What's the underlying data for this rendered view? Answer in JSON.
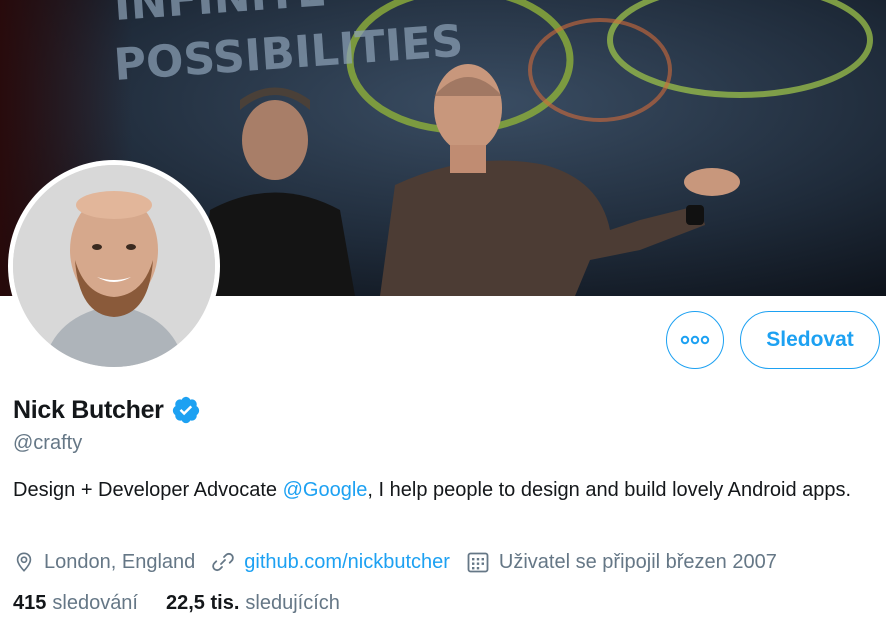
{
  "banner": {
    "slogan_line1": "INFINITE",
    "slogan_line2": "POSSIBILITIES"
  },
  "actions": {
    "more_label": "•••",
    "follow_label": "Sledovat"
  },
  "profile": {
    "name": "Nick Butcher",
    "handle": "@crafty",
    "bio_pre": "Design + Developer Advocate ",
    "bio_mention": "@Google",
    "bio_post": ", I help people to design and build lovely Android apps."
  },
  "meta": {
    "location": "London, England",
    "website": "github.com/nickbutcher",
    "joined": "Uživatel se připojil březen 2007"
  },
  "stats": {
    "following_count": "415",
    "following_label": "sledování",
    "followers_count": "22,5 tis.",
    "followers_label": "sledujících"
  },
  "colors": {
    "accent": "#1da1f2",
    "text": "#14171a",
    "secondary": "#657786"
  },
  "icons": [
    "verified-badge-icon",
    "more-icon",
    "location-pin-icon",
    "link-icon",
    "calendar-icon"
  ]
}
